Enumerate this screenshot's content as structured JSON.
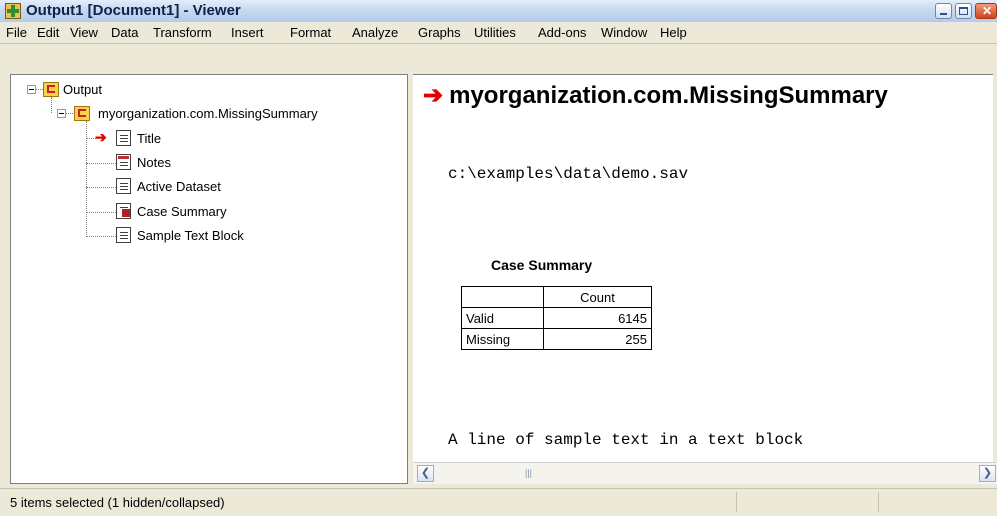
{
  "window": {
    "title": "Output1 [Document1] - Viewer"
  },
  "menu": [
    "File",
    "Edit",
    "View",
    "Data",
    "Transform",
    "Insert",
    "Format",
    "Analyze",
    "Graphs",
    "Utilities",
    "Add-ons",
    "Window",
    "Help"
  ],
  "tree": {
    "root_label": "Output",
    "group_label": "myorganization.com.MissingSummary",
    "items": [
      "Title",
      "Notes",
      "Active Dataset",
      "Case Summary",
      "Sample Text Block"
    ]
  },
  "content": {
    "heading": "myorganization.com.MissingSummary",
    "path": "c:\\examples\\data\\demo.sav",
    "table_title": "Case Summary",
    "table": {
      "header": "Count",
      "rows": [
        {
          "label": "Valid",
          "value": "6145"
        },
        {
          "label": "Missing",
          "value": "255"
        }
      ]
    },
    "sample_text": "A line of sample text in a text block"
  },
  "status": {
    "text": "5 items selected (1 hidden/collapsed)"
  },
  "colors": {
    "accent": "#e00000",
    "titlebar": "#c7d9f1"
  }
}
